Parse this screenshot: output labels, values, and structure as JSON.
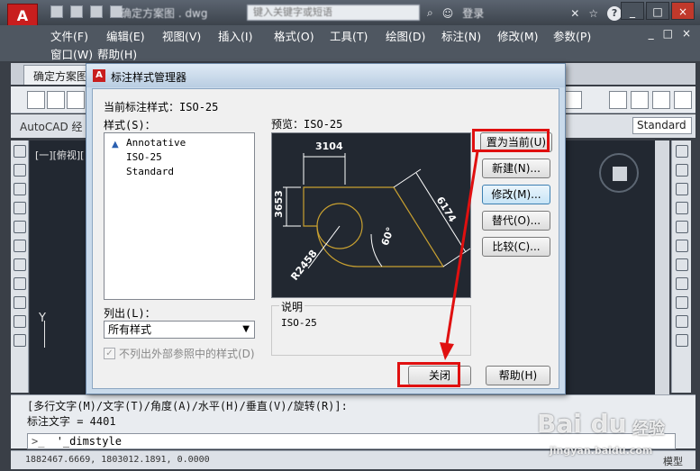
{
  "titlebar": {
    "logo": "A",
    "doc_title": "确定方案图 . dwg",
    "search_placeholder": "键入关键字或短语",
    "login_label": "登录",
    "help_icon": "?"
  },
  "menu": {
    "row1": [
      "文件(F)",
      "编辑(E)",
      "视图(V)",
      "插入(I)",
      "格式(O)",
      "工具(T)",
      "绘图(D)",
      "标注(N)",
      "修改(M)",
      "参数(P)"
    ],
    "row2": [
      "窗口(W)",
      "帮助(H)"
    ],
    "doc_controls": [
      "_",
      "□",
      "×"
    ]
  },
  "doc_tab": {
    "label": "确定方案图"
  },
  "toolbar": {
    "workspace_label": "AutoCAD 经",
    "text_style": "Standard"
  },
  "viewport": {
    "label": "[一][俯视][",
    "ucs_y": "Y"
  },
  "command": {
    "line1": "[多行文字(M)/文字(T)/角度(A)/水平(H)/垂直(V)/旋转(R)]:",
    "line2": "标注文字 = 4401",
    "input": "'_dimstyle",
    "prompt_icon": ">_"
  },
  "statusbar": {
    "coords": "1882467.6669,  1803012.1891,  0.0000",
    "right_label": "模型"
  },
  "dialog": {
    "title": "标注样式管理器",
    "current_style_label": "当前标注样式：",
    "current_style_value": "ISO-25",
    "styles_label": "样式(S)：",
    "styles": [
      "Annotative",
      "ISO-25",
      "Standard"
    ],
    "preview_label": "预览：",
    "preview_value": "ISO-25",
    "list_label": "列出(L)：",
    "list_value": "所有样式",
    "exclude_xref_label": "不列出外部参照中的样式(D)",
    "description_label": "说明",
    "description_value": "ISO-25",
    "buttons": {
      "set_current": "置为当前(U)",
      "new": "新建(N)...",
      "modify": "修改(M)...",
      "override": "替代(O)...",
      "compare": "比较(C)...",
      "close": "关闭",
      "help": "帮助(H)"
    },
    "preview_dims": {
      "top": "3104",
      "left": "3653",
      "diag": "6174",
      "angle": "60°",
      "radius": "R2458"
    }
  },
  "watermark": {
    "brand": "Bai du",
    "suffix": "经验",
    "url": "jingyan.baidu.com"
  },
  "colors": {
    "highlight": "#e01010",
    "preview_bg": "#222831",
    "geometry": "#c8a030",
    "dim_lines": "#ffffff"
  }
}
